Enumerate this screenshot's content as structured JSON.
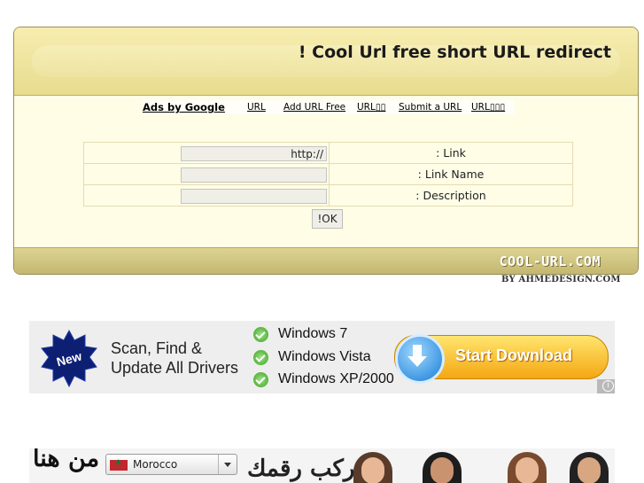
{
  "header": {
    "title": "! Cool Url free short URL redirect"
  },
  "links": {
    "ads": "Ads by Google",
    "items": [
      "URL",
      "Add URL Free",
      "URL▯▯",
      "Submit a URL",
      "URL▯▯▯"
    ]
  },
  "form": {
    "link_label": ": Link",
    "link_value": "//:http",
    "name_label": ": Link Name",
    "name_value": "",
    "desc_label": ": Description",
    "desc_value": "",
    "ok_label": "!OK"
  },
  "footer": {
    "logo": "COOL-URL.COM",
    "byline": "BY AHMEDESIGN.COM"
  },
  "ad_banner": {
    "headline_1": "Scan, Find &",
    "headline_2": "Update All Drivers",
    "badge": "New",
    "os_list": [
      "Windows 7",
      "Windows Vista",
      "Windows XP/2000"
    ],
    "button_label": "Start Download"
  },
  "ad_banner_2": {
    "arabic_text": "من هنا",
    "arabic_text_2": "ركب رقمك",
    "country_selected": "Morocco"
  },
  "colors": {
    "panel_bg": "#fffde6",
    "panel_header": "#efe49c",
    "download_button": "#f8c53a"
  }
}
